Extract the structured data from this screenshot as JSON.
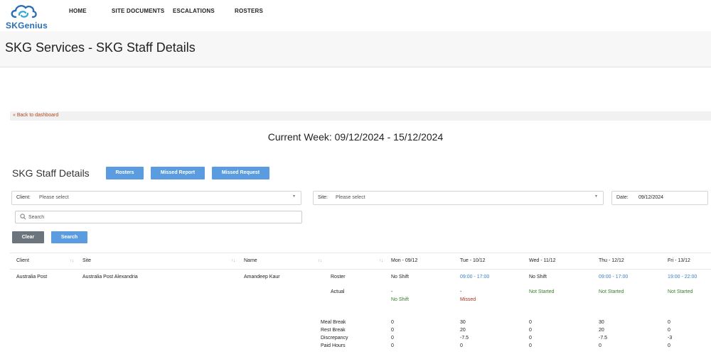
{
  "header": {
    "brand": "SKGenius",
    "nav": [
      "HOME",
      "SITE DOCUMENTS",
      "ESCALATIONS",
      "ROSTERS"
    ]
  },
  "page": {
    "title": "SKG Services - SKG Staff Details",
    "back_link": "« Back to dashboard",
    "current_week": "Current Week: 09/12/2024 - 15/12/2024",
    "section_title": "SKG Staff Details"
  },
  "toolbar": {
    "rosters": "Rosters",
    "missed_report": "Missed Report",
    "missed_request": "Missed Request"
  },
  "filters": {
    "client_label": "Client:",
    "client_value": "Please select",
    "site_label": "Site:",
    "site_value": "Please select",
    "date_label": "Date:",
    "date_value": "09/12/2024",
    "search_placeholder": "Search",
    "clear": "Clear",
    "search_button": "Search"
  },
  "table": {
    "columns": [
      "Client",
      "Site",
      "Name",
      "",
      "Mon - 09/12",
      "Tue - 10/12",
      "Wed - 11/12",
      "Thu - 12/12",
      "Fri - 13/12"
    ],
    "row": {
      "client": "Australia Post",
      "site": "Australia Post Alexandria",
      "name": "Amandeep Kaur",
      "labels": {
        "roster": "Roster",
        "actual": "Actual",
        "meal_break": "Meal Break",
        "rest_break": "Rest Break",
        "discrepancy": "Discrepancy",
        "paid_hours": "Paid Hours"
      },
      "days": [
        {
          "roster": "No Shift",
          "actual1": "-",
          "actual2": "No Shift",
          "meal": "0",
          "rest": "0",
          "disc": "0",
          "paid": "0"
        },
        {
          "roster": "09:00 - 17:00",
          "actual1": "-",
          "actual2": "Missed",
          "meal": "30",
          "rest": "20",
          "disc": "-7.5",
          "paid": "0"
        },
        {
          "roster": "No Shift",
          "actual1": "",
          "actual2": "Not Started",
          "meal": "0",
          "rest": "0",
          "disc": "0",
          "paid": "0"
        },
        {
          "roster": "09:00 - 17:00",
          "actual1": "",
          "actual2": "Not Started",
          "meal": "30",
          "rest": "20",
          "disc": "-7.5",
          "paid": "0"
        },
        {
          "roster": "19:00 - 22:00",
          "actual1": "",
          "actual2": "Not Started",
          "meal": "0",
          "rest": "0",
          "disc": "-3",
          "paid": "0"
        }
      ]
    }
  },
  "colors": {
    "accent": "#5b9bdf",
    "link_blue": "#3b7ec8",
    "status_green": "#3a7d2c",
    "status_red": "#a3321c",
    "clear_button": "#6c757d"
  }
}
